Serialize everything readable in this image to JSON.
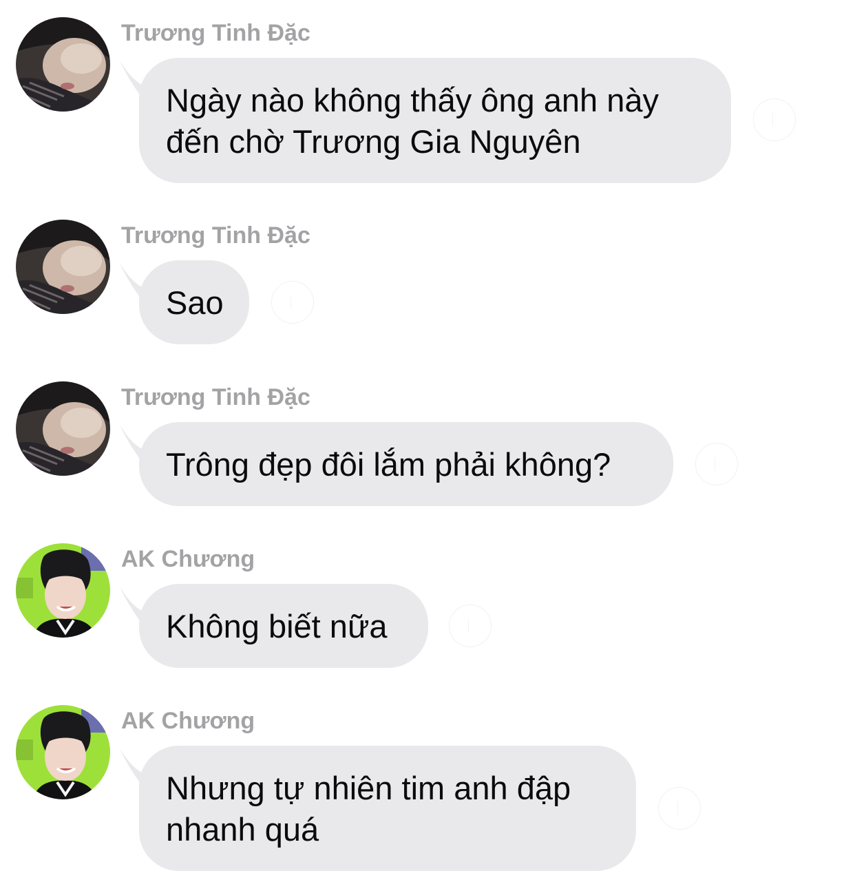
{
  "messages": [
    {
      "sender": "Trương Tinh Đặc",
      "avatar_icon": "avatar-truong-tinh-dac",
      "lines": [
        "Ngày nào không thấy ông anh này",
        "đến chờ Trương Gia Nguyên"
      ]
    },
    {
      "sender": "Trương Tinh Đặc",
      "avatar_icon": "avatar-truong-tinh-dac",
      "lines": [
        "Sao"
      ]
    },
    {
      "sender": "Trương Tinh Đặc",
      "avatar_icon": "avatar-truong-tinh-dac",
      "lines": [
        "Trông đẹp đôi lắm phải không?"
      ]
    },
    {
      "sender": "AK Chương",
      "avatar_icon": "avatar-ak-chuong",
      "lines": [
        "Không biết nữa"
      ]
    },
    {
      "sender": "AK Chương",
      "avatar_icon": "avatar-ak-chuong",
      "lines": [
        "Nhưng tự nhiên tim anh đập",
        "nhanh quá"
      ]
    }
  ],
  "colors": {
    "bubble": "#e9e9eb",
    "sender_text": "#a3a3a6",
    "message_text": "#0b0b0d"
  }
}
